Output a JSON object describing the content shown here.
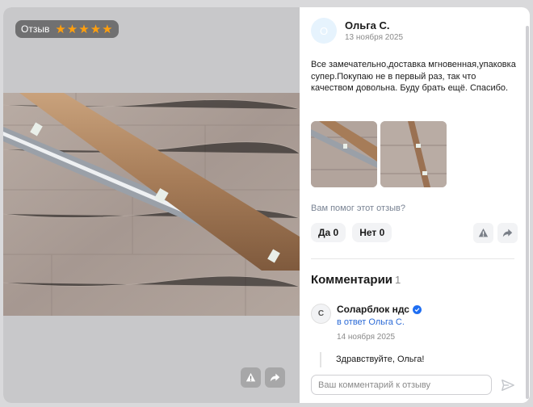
{
  "photo_panel": {
    "rating_label": "Отзыв",
    "rating_stars": 5
  },
  "review": {
    "avatar_letter": "О",
    "author": "Ольга С.",
    "date": "13 ноября 2025",
    "text": "Все замечательно,доставка мгновенная,упаковка супер.Покупаю не в первый раз, так что качеством довольна. Буду брать ещё. Спасибо.",
    "helpful_question": "Вам помог этот отзыв?",
    "yes_label": "Да 0",
    "no_label": "Нет 0"
  },
  "comments": {
    "title": "Комментарии",
    "count": "1",
    "items": [
      {
        "avatar_letter": "С",
        "author": "Соларблок ндс",
        "reply_to": "в ответ Ольга С.",
        "date": "14 ноября 2025",
        "text": "Здравствуйте, Ольга!"
      }
    ],
    "input_placeholder": "Ваш комментарий к отзыву"
  },
  "colors": {
    "star": "#ff9f0e",
    "link": "#2b6ad6",
    "verified": "#1f6ef2"
  }
}
